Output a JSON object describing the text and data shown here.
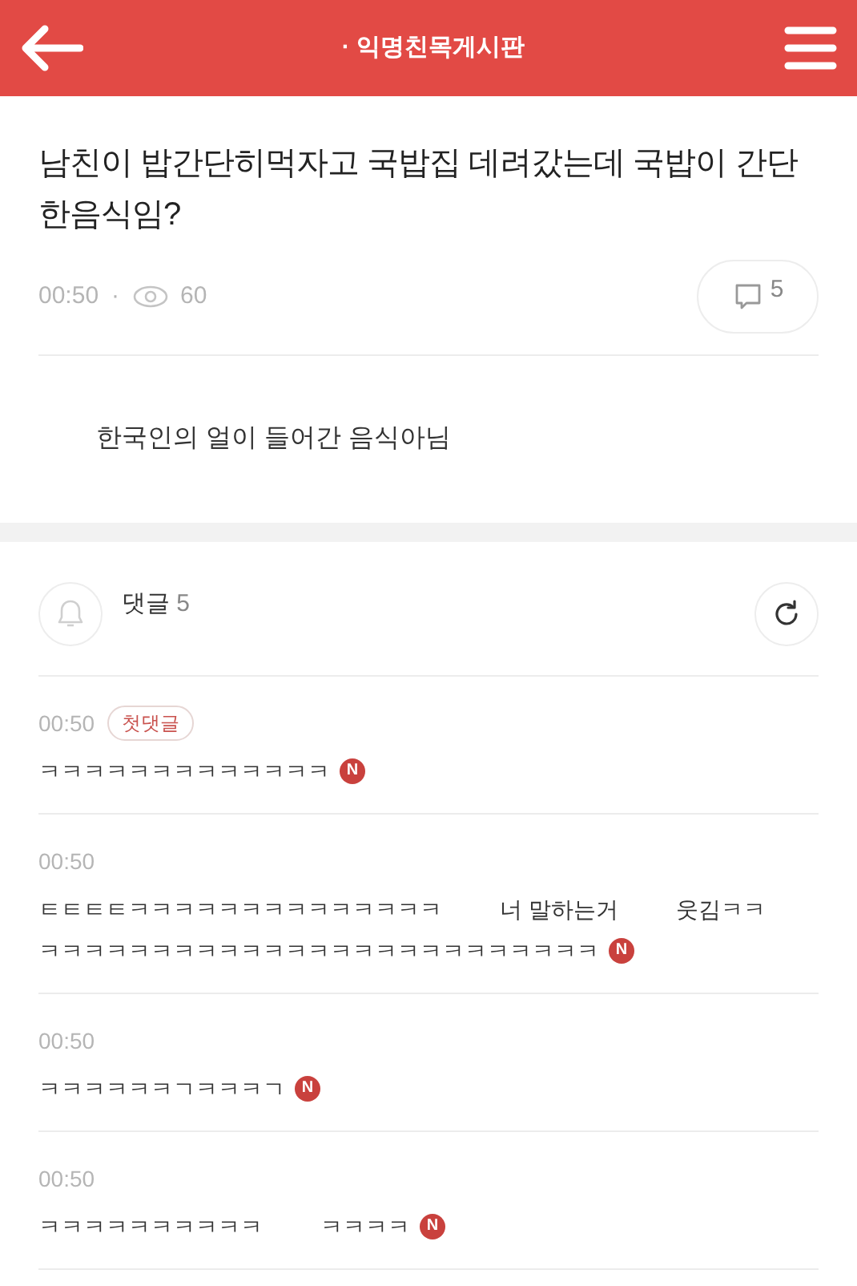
{
  "header": {
    "title": "· 익명친목게시판"
  },
  "post": {
    "title": "남친이 밥간단히먹자고 국밥집 데려갔는데 국밥이 간단한음식임?",
    "time": "00:50",
    "separator": "·",
    "views": "60",
    "comment_count": "5",
    "body": "한국인의 얼이 들어간 음식아님"
  },
  "comments_header": {
    "label": "댓글",
    "count": "5"
  },
  "comments": [
    {
      "time": "00:50",
      "badge": "첫댓글",
      "segments": [
        "ㅋㅋㅋㅋㅋㅋㅋㅋㅋㅋㅋㅋㅋ"
      ],
      "new": true,
      "new_label": "N"
    },
    {
      "time": "00:50",
      "segments": [
        "ㅌㅌㅌㅌㅋㅋㅋㅋㅋㅋㅋㅋㅋㅋㅋㅋㅋㅋ",
        "너 말하는거",
        "웃김ㅋㅋ",
        "ㅋㅋㅋㅋㅋㅋㅋㅋㅋㅋㅋㅋㅋㅋㅋㅋㅋㅋㅋㅋㅋㅋㅋㅋㅋ"
      ],
      "new": true,
      "new_label": "N"
    },
    {
      "time": "00:50",
      "segments": [
        "ㅋㅋㅋㅋㅋㅋㄱㅋㅋㅋㄱ"
      ],
      "new": true,
      "new_label": "N"
    },
    {
      "time": "00:50",
      "segments": [
        "ㅋㅋㅋㅋㅋㅋㅋㅋㅋㅋ",
        "ㅋㅋㅋㅋ"
      ],
      "new": true,
      "new_label": "N"
    }
  ]
}
